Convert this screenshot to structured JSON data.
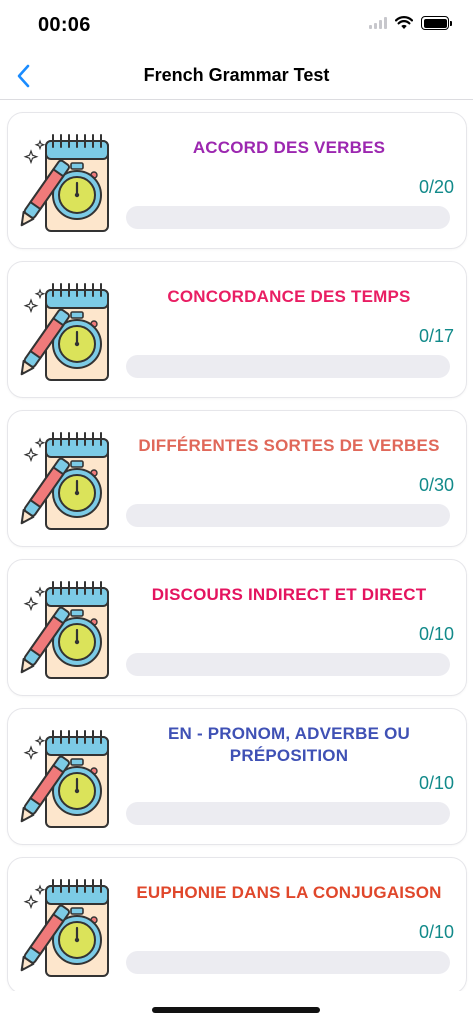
{
  "status_bar": {
    "time": "00:06"
  },
  "nav": {
    "title": "French Grammar Test"
  },
  "colors": {
    "score": "#128a8a",
    "track": "#ececf1",
    "back": "#1a8cff"
  },
  "quizzes": [
    {
      "title": "ACCORD DES VERBES",
      "score": "0/20",
      "progress": 0,
      "color": "#9c27b0"
    },
    {
      "title": "CONCORDANCE DES TEMPS",
      "score": "0/17",
      "progress": 0,
      "color": "#e91e63"
    },
    {
      "title": "DIFFÉRENTES SORTES DE VERBES",
      "score": "0/30",
      "progress": 0,
      "color": "#e0685a"
    },
    {
      "title": "DISCOURS INDIRECT ET DIRECT",
      "score": "0/10",
      "progress": 0,
      "color": "#e4145f"
    },
    {
      "title": "EN - PRONOM, ADVERBE OU PRÉPOSITION",
      "score": "0/10",
      "progress": 0,
      "color": "#3f51b5"
    },
    {
      "title": "EUPHONIE DANS LA CONJUGAISON",
      "score": "0/10",
      "progress": 0,
      "color": "#e0472b"
    }
  ],
  "icons": {
    "back": "chevron-left-icon",
    "card": "notebook-stopwatch-icon",
    "wifi": "wifi-icon",
    "battery": "battery-icon",
    "signal": "signal-icon"
  }
}
